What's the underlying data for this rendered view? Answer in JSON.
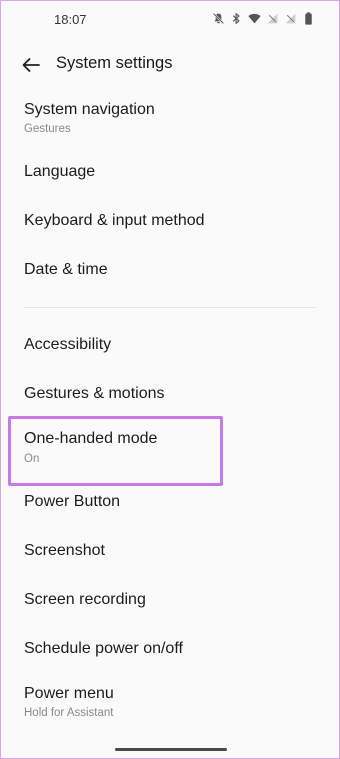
{
  "status_bar": {
    "time": "18:07",
    "icons": [
      "mute-icon",
      "bluetooth-icon",
      "wifi-icon",
      "no-signal-icon",
      "no-signal-icon",
      "battery-icon"
    ]
  },
  "header": {
    "title": "System settings"
  },
  "items": [
    {
      "title": "System navigation",
      "subtitle": "Gestures"
    },
    {
      "title": "Language"
    },
    {
      "title": "Keyboard & input method"
    },
    {
      "title": "Date & time"
    },
    {
      "title": "Accessibility"
    },
    {
      "title": "Gestures & motions"
    },
    {
      "title": "One-handed mode",
      "subtitle": "On"
    },
    {
      "title": "Power Button"
    },
    {
      "title": "Screenshot"
    },
    {
      "title": "Screen recording"
    },
    {
      "title": "Schedule power on/off"
    },
    {
      "title": "Power menu",
      "subtitle": "Hold for Assistant"
    }
  ],
  "colors": {
    "background": "#fafafa",
    "highlight": "#c77ae6",
    "text_primary": "#1c1c1c",
    "text_secondary": "#8a8a8a"
  }
}
